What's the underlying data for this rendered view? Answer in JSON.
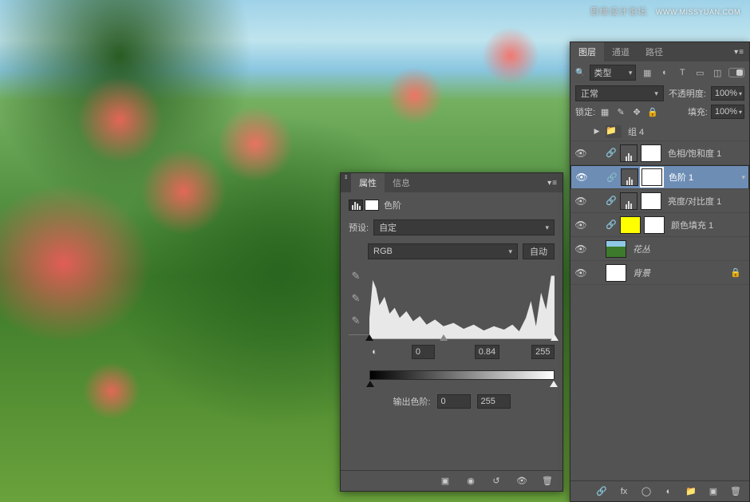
{
  "watermark": {
    "text": "思缘设计论坛",
    "url": "WWW.MISSYUAN.COM"
  },
  "properties_panel": {
    "tabs": {
      "properties": "属性",
      "info": "信息"
    },
    "adj_type": "色阶",
    "preset_label": "预设:",
    "preset_value": "自定",
    "channel_value": "RGB",
    "auto_btn": "自动",
    "input_black": "0",
    "input_gamma": "0.84",
    "input_white": "255",
    "output_label": "输出色阶:",
    "output_black": "0",
    "output_white": "255"
  },
  "layers_panel": {
    "tabs": {
      "layers": "图层",
      "channels": "通道",
      "paths": "路径"
    },
    "kind_label": "类型",
    "blend_mode": "正常",
    "opacity_label": "不透明度:",
    "opacity_value": "100%",
    "lock_label": "锁定:",
    "fill_label": "填充:",
    "fill_value": "100%",
    "entries": {
      "group": "组 4",
      "hsl": "色相/饱和度 1",
      "levels": "色阶 1",
      "bc": "亮度/对比度 1",
      "fill": "颜色填充 1",
      "flowers": "花丛",
      "bg": "背景"
    }
  }
}
